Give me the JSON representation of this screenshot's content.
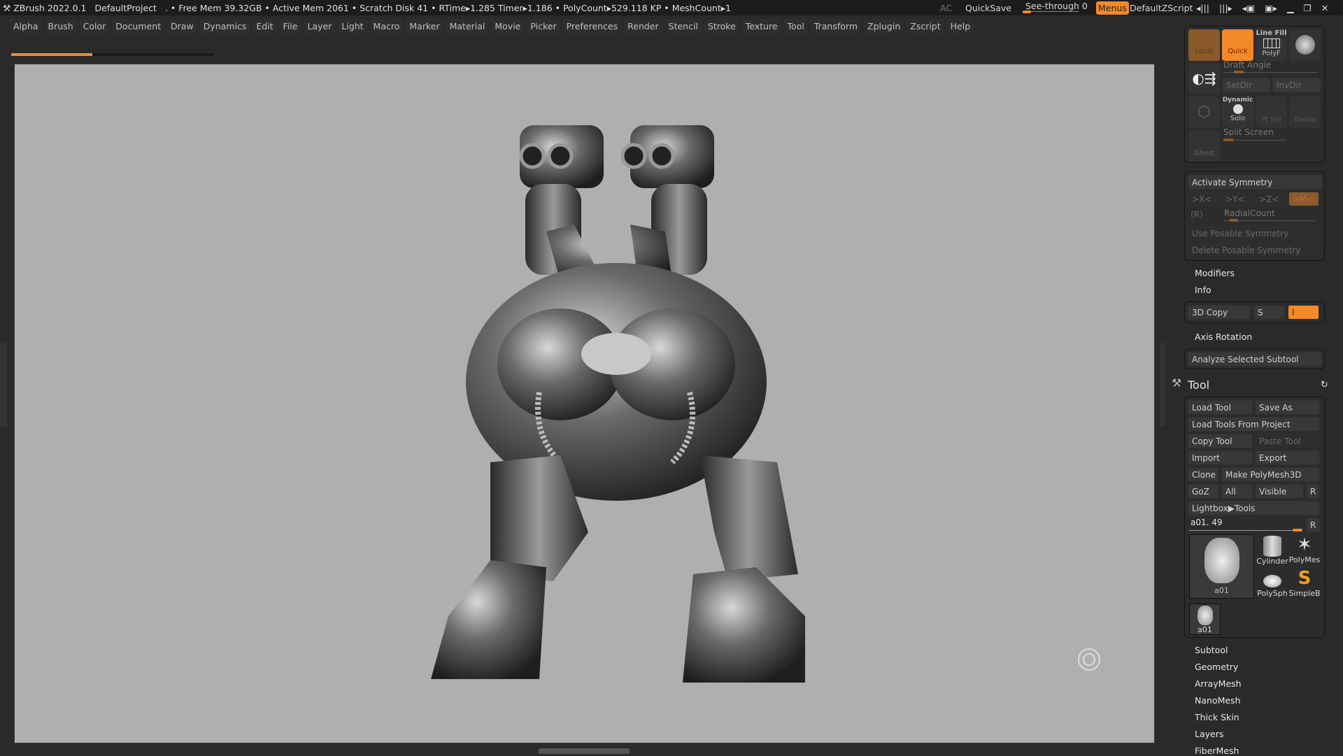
{
  "titlebar": {
    "app": "ZBrush 2022.0.1",
    "project": "DefaultProject",
    "stats": ". • Free Mem 39.32GB • Active Mem 2061 • Scratch Disk 41 •  RTime▸1.285 Timer▸1.186 • PolyCount▸529.118 KP  • MeshCount▸1",
    "ac": "AC",
    "quicksave": "QuickSave",
    "seethrough": "See-through  0",
    "menus": "Menus",
    "script": "DefaultZScript"
  },
  "menus": [
    "Alpha",
    "Brush",
    "Color",
    "Document",
    "Draw",
    "Dynamics",
    "Edit",
    "File",
    "Layer",
    "Light",
    "Macro",
    "Marker",
    "Material",
    "Movie",
    "Picker",
    "Preferences",
    "Render",
    "Stencil",
    "Stroke",
    "Texture",
    "Tool",
    "Transform",
    "Zplugin",
    "Zscript",
    "Help"
  ],
  "progress": 0.4,
  "transform": {
    "local": "Local",
    "quick": "Quick",
    "linefill": "Line Fill",
    "polyf": "PolyF",
    "draft_angle": "Draft Angle",
    "setdir": "SetDir",
    "invdir": "InvDir",
    "dynamic": "Dynamic",
    "solo": "Solo",
    "ptsel": "Pt Sel",
    "transp": "Transp",
    "ghost": "Ghost",
    "split_screen": "Split Screen"
  },
  "symmetry": {
    "activate": "Activate Symmetry",
    "x": ">X<",
    "y": ">Y<",
    "z": ">Z<",
    "m": ">M<",
    "r": "(R)",
    "radial": "RadialCount",
    "use_posable": "Use Posable Symmetry",
    "delete_posable": "Delete Posable Symmetry"
  },
  "sections": {
    "modifiers": "Modifiers",
    "info": "Info",
    "copy3d": "3D Copy",
    "s": "S",
    "i": "I",
    "axis_rotation": "Axis Rotation",
    "analyze": "Analyze Selected Subtool"
  },
  "tool": {
    "title": "Tool",
    "load": "Load Tool",
    "save_as": "Save As",
    "load_project": "Load Tools From Project",
    "copy": "Copy Tool",
    "paste": "Paste Tool",
    "import": "Import",
    "export": "Export",
    "clone": "Clone",
    "make_polymesh": "Make PolyMesh3D",
    "goz": "GoZ",
    "all": "All",
    "visible": "Visible",
    "r": "R",
    "lightbox": "Lightbox▶Tools",
    "slider": "a01. 49",
    "thumbs": [
      "a01",
      "Cylinder",
      "PolyMes",
      "PolySph",
      "SimpleB",
      "a01"
    ]
  },
  "subpalettes": [
    "Subtool",
    "Geometry",
    "ArrayMesh",
    "NanoMesh",
    "Thick Skin",
    "Layers",
    "FiberMesh"
  ],
  "colors": {
    "accent": "#f28a2a",
    "viewport": "#afafaf"
  }
}
